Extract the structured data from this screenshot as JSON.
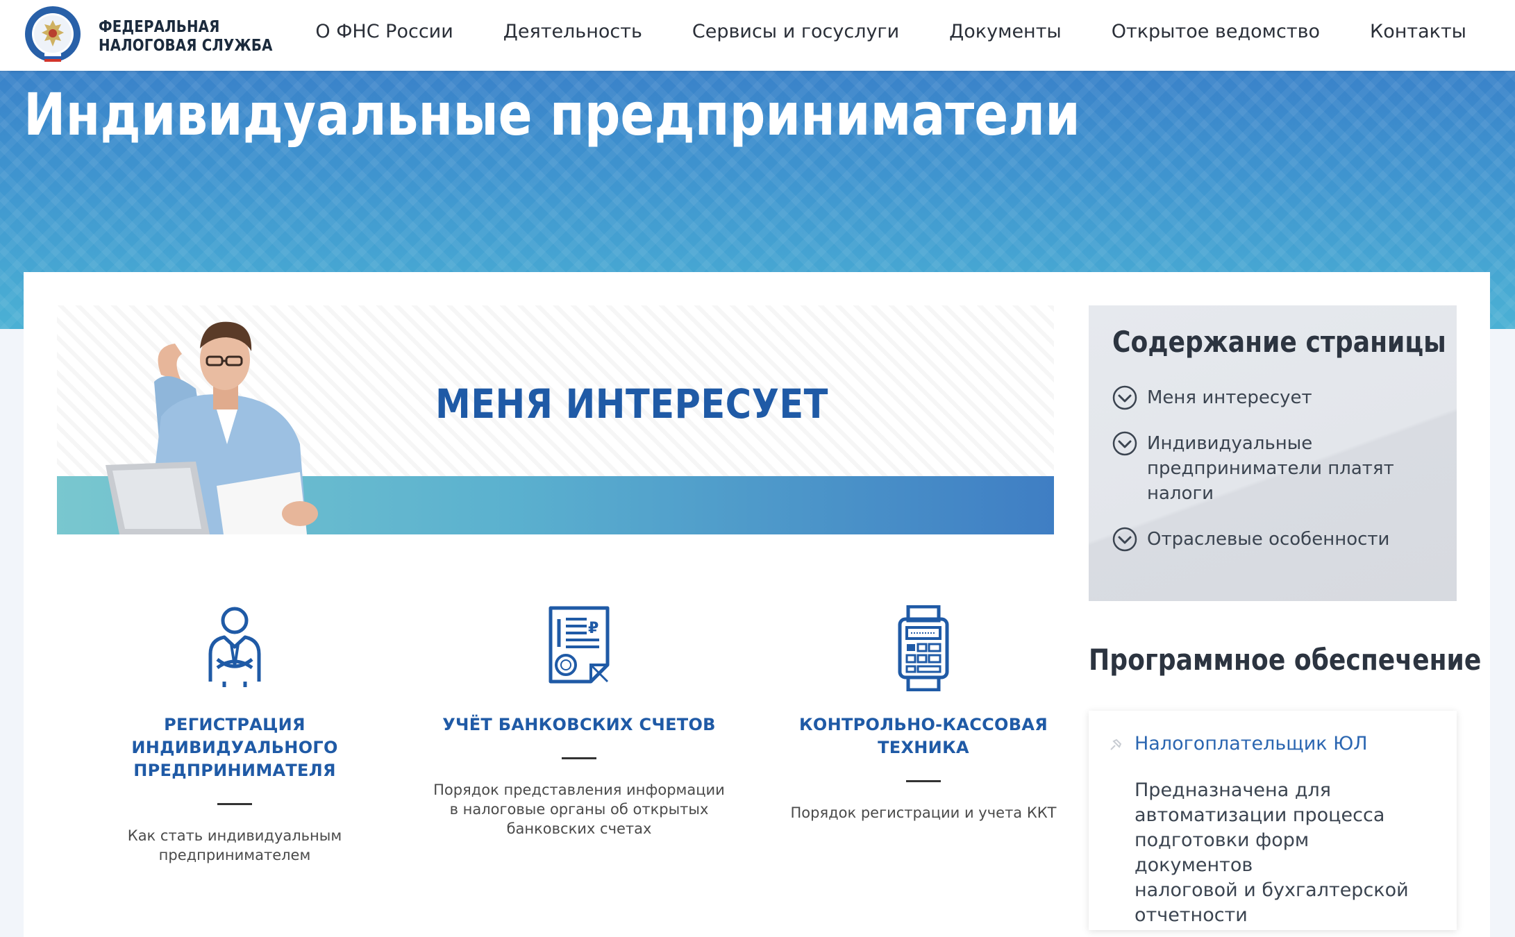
{
  "brand": {
    "line1": "ФЕДЕРАЛЬНАЯ",
    "line2": "НАЛОГОВАЯ СЛУЖБА"
  },
  "nav": [
    {
      "label": "О ФНС России"
    },
    {
      "label": "Деятельность"
    },
    {
      "label": "Сервисы и госуслуги"
    },
    {
      "label": "Документы"
    },
    {
      "label": "Открытое ведомство"
    },
    {
      "label": "Контакты"
    }
  ],
  "hero": {
    "title": "Индивидуальные предприниматели"
  },
  "banner": {
    "title": "МЕНЯ ИНТЕРЕСУЕТ"
  },
  "features": [
    {
      "icon": "businessman-icon",
      "title_lines": [
        "РЕГИСТРАЦИЯ",
        "ИНДИВИДУАЛЬНОГО",
        "ПРЕДПРИНИМАТЕЛЯ"
      ],
      "desc_lines": [
        "Как стать индивидуальным",
        "предпринимателем"
      ]
    },
    {
      "icon": "ruble-document-icon",
      "title_lines": [
        "УЧЁТ БАНКОВСКИХ СЧЕТОВ"
      ],
      "desc_lines": [
        "Порядок представления информации",
        "в налоговые органы об открытых",
        "банковских счетах"
      ]
    },
    {
      "icon": "cash-register-icon",
      "title_lines": [
        "КОНТРОЛЬНО-КАССОВАЯ",
        "ТЕХНИКА"
      ],
      "desc_lines": [
        "Порядок регистрации и учета ККТ"
      ]
    }
  ],
  "toc": {
    "title": "Содержание страницы",
    "items": [
      {
        "label": "Меня интересует"
      },
      {
        "label_lines": [
          "Индивидуальные",
          "предприниматели платят",
          "налоги"
        ]
      },
      {
        "label": "Отраслевые особенности"
      }
    ]
  },
  "software": {
    "title": "Программное обеспечение",
    "link": "Налогоплательщик ЮЛ",
    "desc_lines": [
      "Предназначена для",
      "автоматизации процесса",
      "подготовки форм документов",
      "налоговой и бухгалтерской",
      "отчетности"
    ]
  },
  "colors": {
    "accent": "#1f5aa6",
    "link": "#2b66b1",
    "hero_top": "#3a82c9",
    "hero_bottom": "#4bb1d4"
  }
}
